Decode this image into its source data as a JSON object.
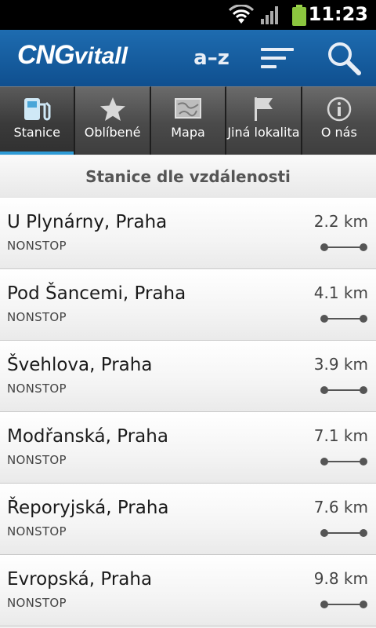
{
  "status_bar": {
    "time": "11:23",
    "icons": [
      "wifi-icon",
      "signal-icon",
      "battery-icon"
    ]
  },
  "app_bar": {
    "logo_part1": "CNG",
    "logo_part2": "vitall",
    "sort_az_label": "a–z",
    "icons": [
      "sort-icon",
      "search-icon"
    ]
  },
  "tabs": [
    {
      "label": "Stanice",
      "icon": "fuel-pump-icon",
      "active": true
    },
    {
      "label": "Oblíbené",
      "icon": "star-icon",
      "active": false
    },
    {
      "label": "Mapa",
      "icon": "map-icon",
      "active": false
    },
    {
      "label": "Jiná lokalita",
      "icon": "flag-icon",
      "active": false
    },
    {
      "label": "O nás",
      "icon": "info-icon",
      "active": false
    }
  ],
  "section_title": "Stanice dle vzdálenosti",
  "stations": [
    {
      "name": "U Plynárny, Praha",
      "hours": "NONSTOP",
      "distance": "2.2 km"
    },
    {
      "name": "Pod Šancemi, Praha",
      "hours": "NONSTOP",
      "distance": "4.1 km"
    },
    {
      "name": "Švehlova, Praha",
      "hours": "NONSTOP",
      "distance": "3.9 km"
    },
    {
      "name": "Modřanská, Praha",
      "hours": "NONSTOP",
      "distance": "7.1 km"
    },
    {
      "name": "Řeporyjská, Praha",
      "hours": "NONSTOP",
      "distance": "7.6 km"
    },
    {
      "name": "Evropská, Praha",
      "hours": "NONSTOP",
      "distance": "9.8 km"
    }
  ],
  "colors": {
    "header_blue": "#1566a8",
    "tab_active_underline": "#2e9bd6",
    "status_bar": "#000000"
  }
}
